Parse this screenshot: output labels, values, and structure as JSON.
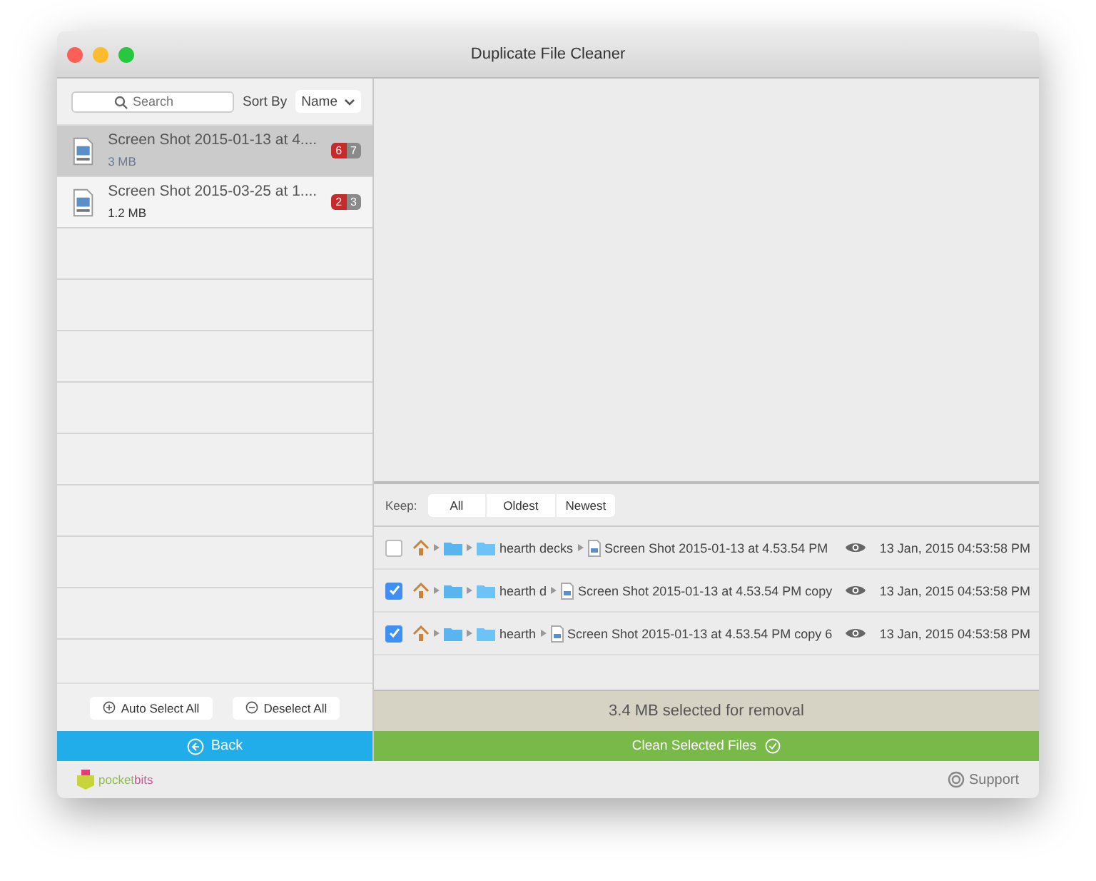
{
  "window": {
    "title": "Duplicate File Cleaner"
  },
  "sidebar": {
    "search": {
      "placeholder": "Search"
    },
    "sort_label": "Sort By",
    "sort_value": "Name",
    "items": [
      {
        "name": "Screen Shot 2015-01-13 at 4....",
        "size": "3 MB",
        "count_red": "6",
        "count_grey": "7",
        "selected": true
      },
      {
        "name": "Screen Shot 2015-03-25 at 1....",
        "size": "1.2 MB",
        "count_red": "2",
        "count_grey": "3",
        "selected": false
      }
    ],
    "auto_select": "Auto Select All",
    "deselect": "Deselect All",
    "back": "Back"
  },
  "keep": {
    "label": "Keep:",
    "options": [
      {
        "label": "All",
        "selected": false
      },
      {
        "label": "Oldest",
        "selected": false
      },
      {
        "label": "Newest",
        "selected": false
      }
    ]
  },
  "files": [
    {
      "checked": false,
      "folder": "hearth decks",
      "file": "Screen Shot 2015-01-13 at 4.53.54 PM",
      "date": "13 Jan, 2015 04:53:58 PM"
    },
    {
      "checked": true,
      "folder": "hearth d",
      "file": "Screen Shot 2015-01-13 at 4.53.54 PM copy",
      "date": "13 Jan, 2015 04:53:58 PM"
    },
    {
      "checked": true,
      "folder": "hearth",
      "file": "Screen Shot 2015-01-13 at 4.53.54 PM copy 6",
      "date": "13 Jan, 2015 04:53:58 PM"
    }
  ],
  "summary": "3.4 MB selected for removal",
  "clean_button": "Clean Selected Files",
  "footer": {
    "logo_part_1": "pocket",
    "logo_part_2": "bits",
    "support": "Support"
  }
}
